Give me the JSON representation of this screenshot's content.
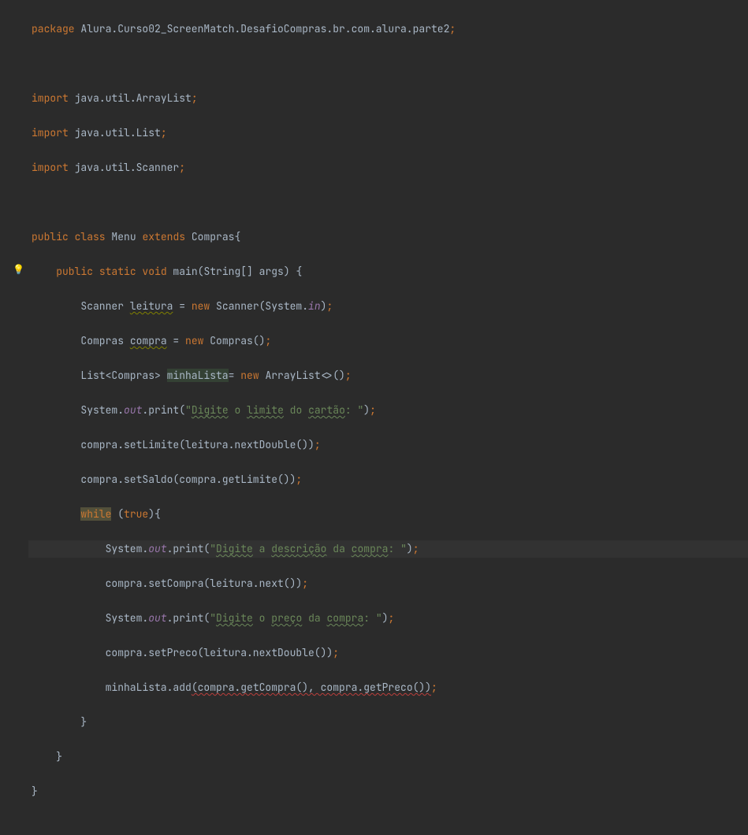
{
  "code": {
    "line1_pkg": "package",
    "line1_path": " Alura.Curso02_ScreenMatch.DesafioCompras.br.com.alura.parte2",
    "line1_semi": ";",
    "line3_imp": "import",
    "line3_path": " java.util.ArrayList",
    "line3_semi": ";",
    "line4_imp": "import",
    "line4_path": " java.util.List",
    "line4_semi": ";",
    "line5_imp": "import",
    "line5_path": " java.util.Scanner",
    "line5_semi": ";",
    "line7_public": "public ",
    "line7_class": "class",
    "line7_name": " Menu ",
    "line7_extends": "extends",
    "line7_super": " Compras{",
    "line8_public": "public ",
    "line8_static": "static ",
    "line8_void": "void",
    "line8_main": " main",
    "line8_sig": "(String[] args) {",
    "line9_a": "Scanner ",
    "line9_var": "leitura",
    "line9_b": " = ",
    "line9_new": "new",
    "line9_c": " Scanner(System.",
    "line9_in": "in",
    "line9_d": ")",
    "line9_semi": ";",
    "line10_a": "Compras ",
    "line10_var": "compra",
    "line10_b": " = ",
    "line10_new": "new",
    "line10_c": " Compras()",
    "line10_semi": ";",
    "line11_a": "List<Compras> ",
    "line11_var": "minhaLista",
    "line11_b": "= ",
    "line11_new": "new",
    "line11_c": " ArrayList<>()",
    "line11_semi": ";",
    "line12_a": "System.",
    "line12_out": "out",
    "line12_b": ".print(",
    "line12_s1": "\"",
    "line12_s2": "Digite",
    "line12_s3": " o ",
    "line12_s4": "limite",
    "line12_s5": " do ",
    "line12_s6": "cartão",
    "line12_s7": ": \"",
    "line12_c": ")",
    "line12_semi": ";",
    "line13_a": "compra.setLimite(leitura.nextDouble())",
    "line13_semi": ";",
    "line14_a": "compra.setSaldo(compra.getLimite())",
    "line14_semi": ";",
    "line15_while": "while",
    "line15_a": " (",
    "line15_true": "true",
    "line15_b": "){",
    "line16_a": "System.",
    "line16_out": "out",
    "line16_b": ".print(",
    "line16_s1": "\"",
    "line16_s2": "Digite",
    "line16_s3": " a ",
    "line16_s4": "descrição",
    "line16_s5": " da ",
    "line16_s6": "compra",
    "line16_s7": ": \"",
    "line16_c": ")",
    "line16_semi": ";",
    "line17_a": "compra.setCompra(leitura.next())",
    "line17_semi": ";",
    "line18_a": "System.",
    "line18_out": "out",
    "line18_b": ".print(",
    "line18_s1": "\"",
    "line18_s2": "Digite",
    "line18_s3": " o ",
    "line18_s4": "preço",
    "line18_s5": " da ",
    "line18_s6": "compra",
    "line18_s7": ": \"",
    "line18_c": ")",
    "line18_semi": ";",
    "line19_a": "compra.setPreco(leitura.nextDouble())",
    "line19_semi": ";",
    "line20_a": "minhaLista.add",
    "line20_err": "(compra.getCompra(), compra.getPreco())",
    "line20_semi": ";",
    "line21": "}",
    "line22": "}",
    "line23": "}"
  }
}
